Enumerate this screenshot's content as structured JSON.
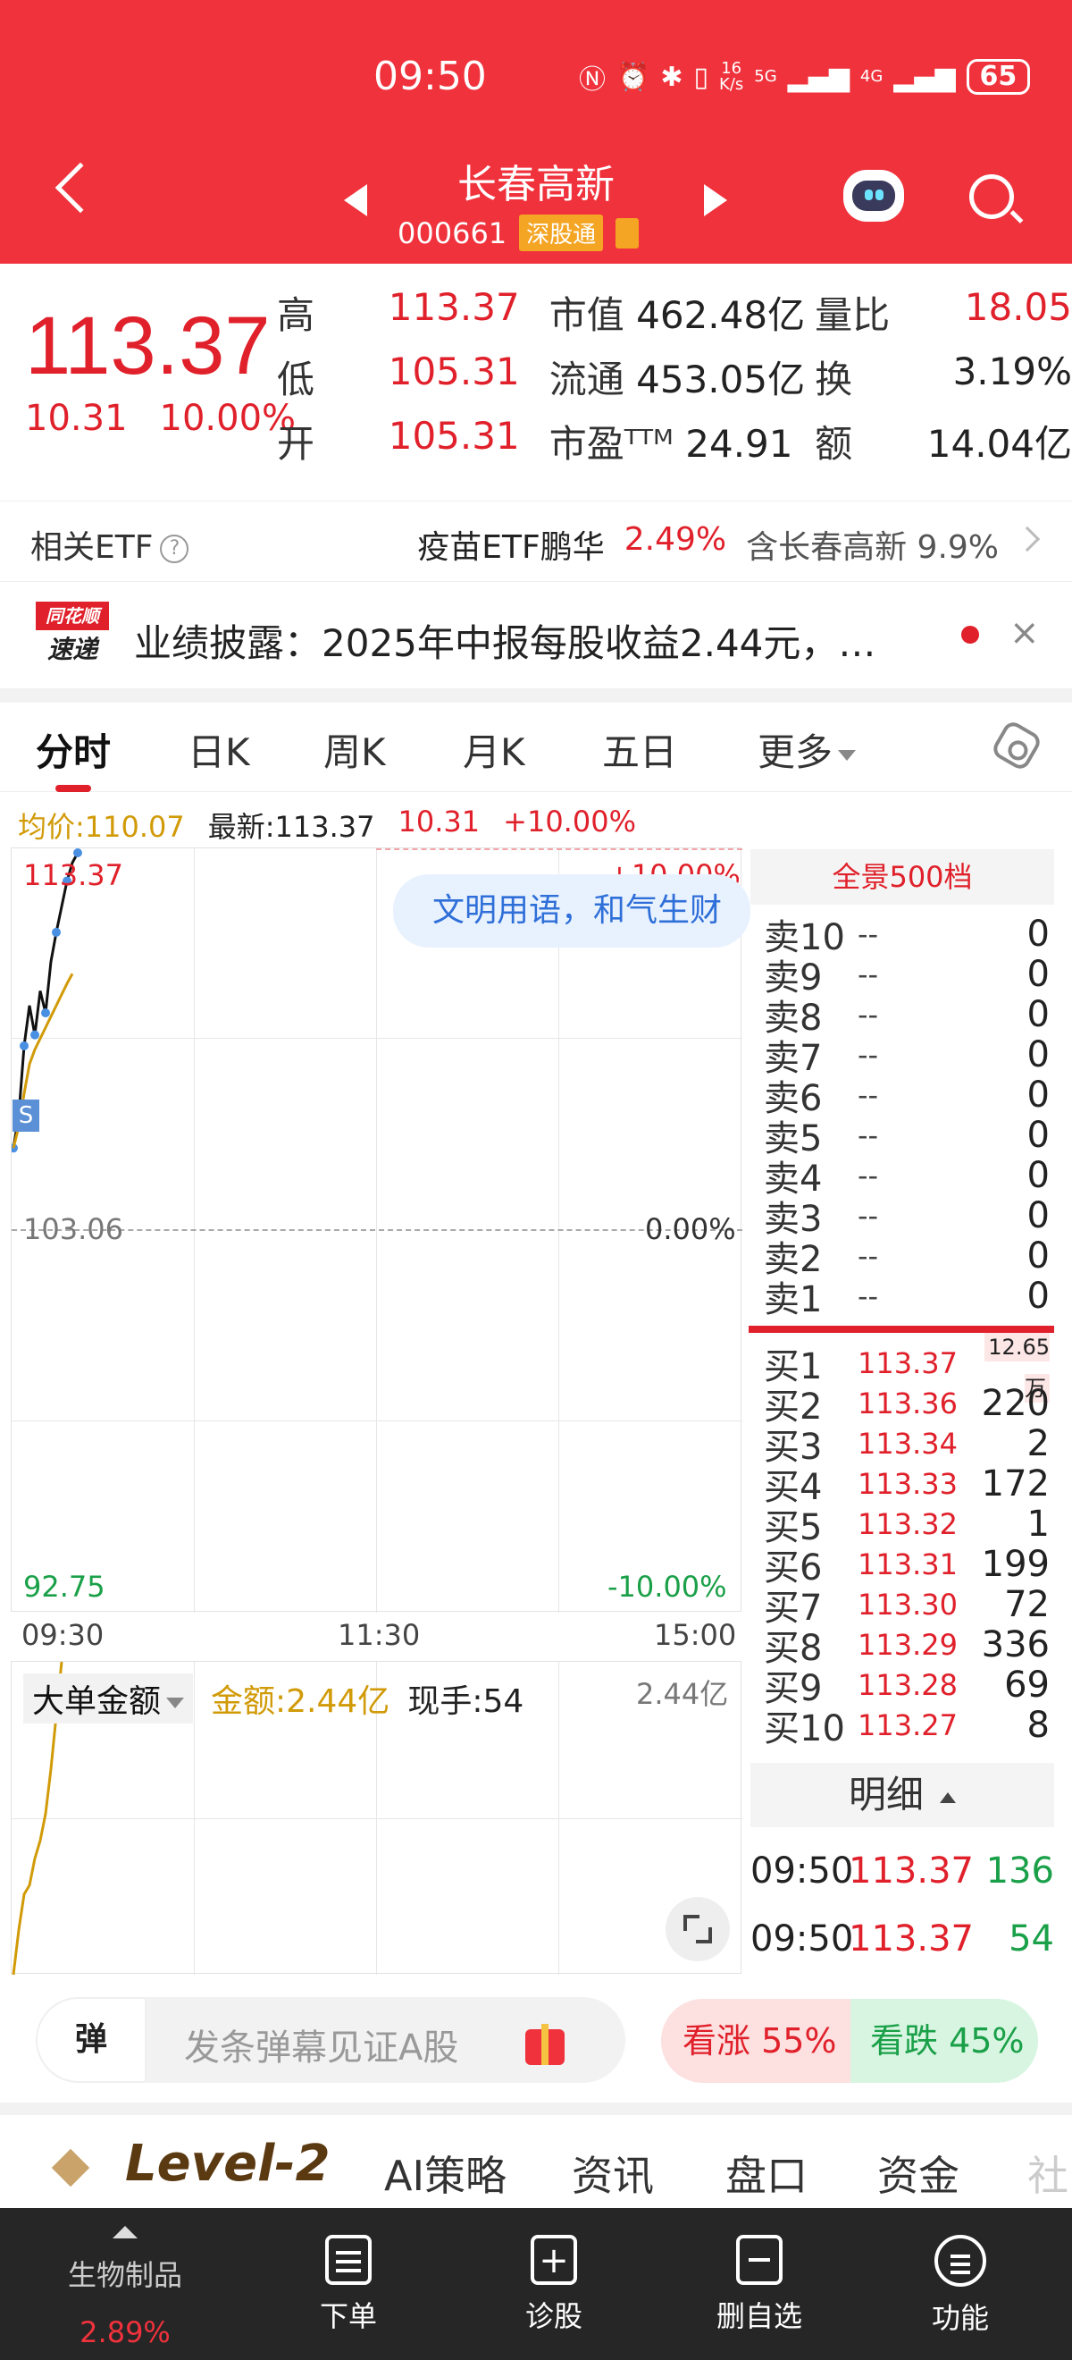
{
  "status": {
    "time": "09:50",
    "net_speed_top": "16",
    "net_speed_bottom": "K/s",
    "signal1": "5G",
    "signal2": "4G",
    "battery": "65"
  },
  "header": {
    "name": "长春高新",
    "code": "000661",
    "tag": "深股通"
  },
  "quote": {
    "price": "113.37",
    "change": "10.31",
    "change_pct": "10.00%",
    "rows": [
      {
        "lab": "高",
        "val": "113.37",
        "k": "市值",
        "kv": "462.48亿",
        "lab2": "量比",
        "val2": "18.05"
      },
      {
        "lab": "低",
        "val": "105.31",
        "k": "流通",
        "kv": "453.05亿",
        "lab2": "换",
        "val2": "3.19%"
      },
      {
        "lab": "开",
        "val": "105.31",
        "k": "市盈ᵀᵀᴹ",
        "kv": "24.91",
        "lab2": "额",
        "val2": "14.04亿"
      }
    ]
  },
  "etf": {
    "label": "相关ETF",
    "help": "?",
    "name": "疫苗ETF鹏华",
    "pct": "2.49%",
    "contains": "含长春高新 9.9%"
  },
  "news": {
    "logo_top": "同花顺",
    "logo_bottom": "速递",
    "text": "业绩披露：2025年中报每股收益2.44元，…",
    "close": "×"
  },
  "tabs": [
    "分时",
    "日K",
    "周K",
    "月K",
    "五日",
    "更多"
  ],
  "chart": {
    "avg_label": "均价:110.07",
    "last_label": "最新:113.37",
    "chg": "10.31",
    "chg_pct": "+10.00%",
    "top_price": "113.37",
    "top_pct": "+10.00%",
    "mid_price": "103.06",
    "mid_pct": "0.00%",
    "bottom_price": "92.75",
    "bottom_pct": "-10.00%",
    "bubble": "文明用语，和气生财",
    "s_badge": "S",
    "times": [
      "09:30",
      "11:30",
      "15:00"
    ]
  },
  "chart_data": {
    "type": "line",
    "title": "",
    "xlabel": "",
    "ylabel": "",
    "x_ticks": [
      "09:30",
      "11:30",
      "15:00"
    ],
    "ylim": [
      92.75,
      113.37
    ],
    "series": [
      {
        "name": "最新",
        "values": [
          105.31,
          106.2,
          108.1,
          109.2,
          108.4,
          109.6,
          109.0,
          110.4,
          111.2,
          111.9,
          112.6,
          113.1,
          113.37
        ]
      },
      {
        "name": "均价",
        "values": [
          105.31,
          105.9,
          106.8,
          107.6,
          108.0,
          108.3,
          108.6,
          108.9,
          109.2,
          109.5,
          109.8,
          110.07
        ]
      }
    ]
  },
  "volume": {
    "title": "大单金额",
    "amount": "金额:2.44亿",
    "hand": "现手:54",
    "max": "2.44亿"
  },
  "book": {
    "head": "全景500档",
    "sells": [
      {
        "n": "卖10",
        "p": "--",
        "v": "0"
      },
      {
        "n": "卖9",
        "p": "--",
        "v": "0"
      },
      {
        "n": "卖8",
        "p": "--",
        "v": "0"
      },
      {
        "n": "卖7",
        "p": "--",
        "v": "0"
      },
      {
        "n": "卖6",
        "p": "--",
        "v": "0"
      },
      {
        "n": "卖5",
        "p": "--",
        "v": "0"
      },
      {
        "n": "卖4",
        "p": "--",
        "v": "0"
      },
      {
        "n": "卖3",
        "p": "--",
        "v": "0"
      },
      {
        "n": "卖2",
        "p": "--",
        "v": "0"
      },
      {
        "n": "卖1",
        "p": "--",
        "v": "0"
      }
    ],
    "buys": [
      {
        "n": "买1",
        "p": "113.37",
        "v": "12.65万"
      },
      {
        "n": "买2",
        "p": "113.36",
        "v": "220"
      },
      {
        "n": "买3",
        "p": "113.34",
        "v": "2"
      },
      {
        "n": "买4",
        "p": "113.33",
        "v": "172"
      },
      {
        "n": "买5",
        "p": "113.32",
        "v": "1"
      },
      {
        "n": "买6",
        "p": "113.31",
        "v": "199"
      },
      {
        "n": "买7",
        "p": "113.30",
        "v": "72"
      },
      {
        "n": "买8",
        "p": "113.29",
        "v": "336"
      },
      {
        "n": "买9",
        "p": "113.28",
        "v": "69"
      },
      {
        "n": "买10",
        "p": "113.27",
        "v": "8"
      }
    ],
    "detail_head": "明细",
    "details": [
      {
        "t": "09:50",
        "p": "113.37",
        "v": "136"
      },
      {
        "t": "09:50",
        "p": "113.37",
        "v": "54"
      }
    ]
  },
  "danmu": {
    "icon": "弹",
    "placeholder": "发条弹幕见证A股",
    "bull": "看涨 55%",
    "bear": "看跌 45%"
  },
  "bottom_tabs": {
    "level2": "Level-2",
    "items": [
      "AI策略",
      "资讯",
      "盘口",
      "资金",
      "社"
    ]
  },
  "nav": {
    "sector_name": "生物制品",
    "sector_pct": "2.89%",
    "items": [
      "下单",
      "诊股",
      "删自选",
      "功能"
    ]
  },
  "colors": {
    "brand_red": "#f0323c",
    "rise": "#e0202a",
    "fall": "#1aa048",
    "avg_line": "#d19a07"
  }
}
